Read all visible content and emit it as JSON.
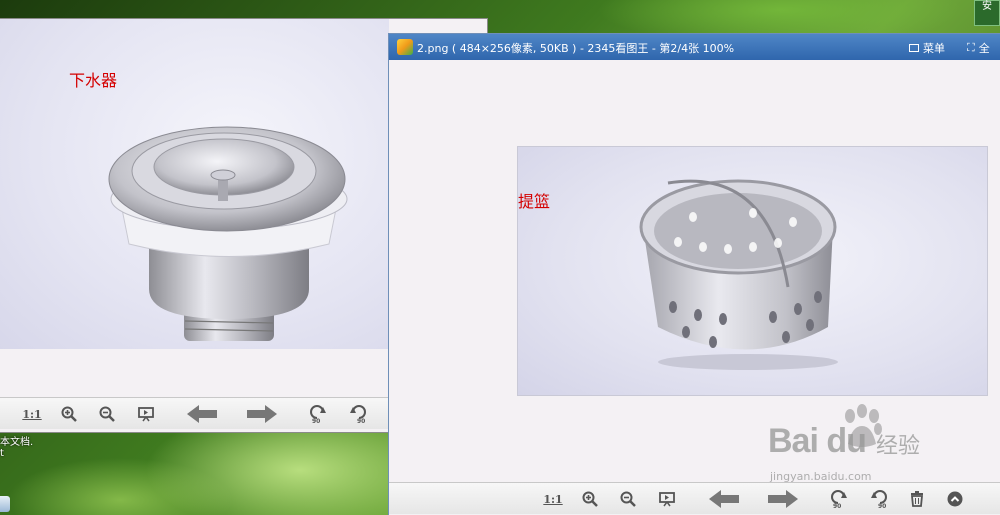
{
  "desktop": {
    "corner_icon_label": "安",
    "text_lines": [
      "本文档.",
      "t"
    ]
  },
  "back_window": {
    "image_label": "下水器",
    "toolbar": {
      "actual_size": "1:1",
      "zoom_in_icon": "zoom-in-icon",
      "zoom_out_icon": "zoom-out-icon",
      "slideshow_icon": "slideshow-icon",
      "prev_icon": "arrow-left-icon",
      "next_icon": "arrow-right-icon",
      "rotate_left_label": "90",
      "rotate_right_label": "90"
    }
  },
  "front_window": {
    "title": "2.png ( 484×256像素, 50KB ) - 2345看图王 - 第2/4张 100%",
    "menu_label": "菜单",
    "fullscreen_label": "全",
    "image_label": "提篮",
    "toolbar": {
      "actual_size": "1:1",
      "rotate_left_label": "90",
      "rotate_right_label": "90",
      "delete_icon": "trash-icon",
      "collapse_icon": "chevron-up-icon"
    }
  },
  "watermark": {
    "logo": "Bai du",
    "cn": "经验",
    "url": "jingyan.baidu.com"
  },
  "colors": {
    "titlebar": "#3a72b8",
    "label_red": "#d40000",
    "toolbar_icon": "#555555"
  }
}
